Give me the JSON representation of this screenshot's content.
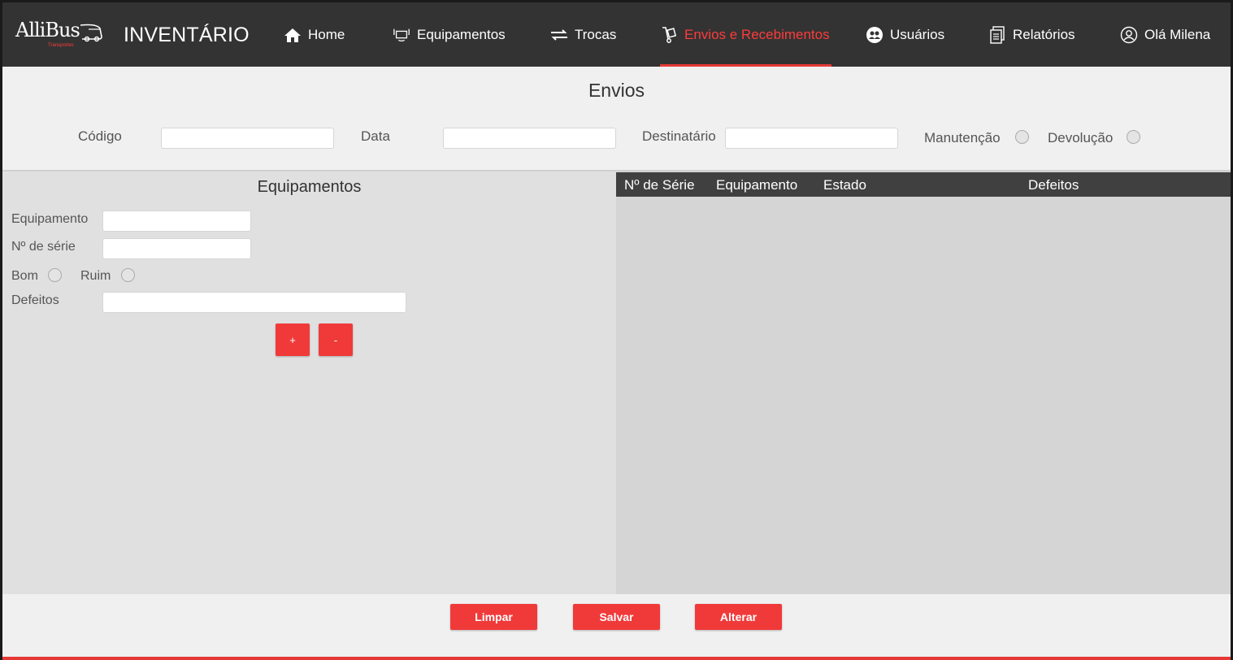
{
  "nav": {
    "logo_text": "AlliBus",
    "logo_sub": "Transportes",
    "app_title": "INVENTÁRIO",
    "items": [
      {
        "label": "Home",
        "icon": "home-icon"
      },
      {
        "label": "Equipamentos",
        "icon": "device-icon"
      },
      {
        "label": "Trocas",
        "icon": "swap-icon"
      },
      {
        "label": "Envios e Recebimentos",
        "icon": "hand-truck-icon",
        "active": true
      },
      {
        "label": "Usuários",
        "icon": "users-icon"
      },
      {
        "label": "Relatórios",
        "icon": "report-icon"
      },
      {
        "label": "Olá Milena",
        "icon": "user-circle-icon"
      }
    ]
  },
  "envios": {
    "title": "Envios",
    "codigo_label": "Código",
    "codigo_value": "",
    "data_label": "Data",
    "data_value": "",
    "destinatario_label": "Destinatário",
    "destinatario_value": "",
    "manutencao_label": "Manutenção",
    "devolucao_label": "Devolução"
  },
  "equipamentos": {
    "title": "Equipamentos",
    "equipamento_label": "Equipamento",
    "serie_label": "Nº de série",
    "bom_label": "Bom",
    "ruim_label": "Ruim",
    "defeitos_label": "Defeitos",
    "add_label": "+",
    "remove_label": "-"
  },
  "table": {
    "columns": [
      "Nº de Série",
      "Equipamento",
      "Estado",
      "Defeitos"
    ],
    "rows": []
  },
  "actions": {
    "limpar": "Limpar",
    "salvar": "Salvar",
    "alterar": "Alterar"
  },
  "colors": {
    "accent": "#f03a3a",
    "navbar": "#333333",
    "table_header": "#404040"
  }
}
